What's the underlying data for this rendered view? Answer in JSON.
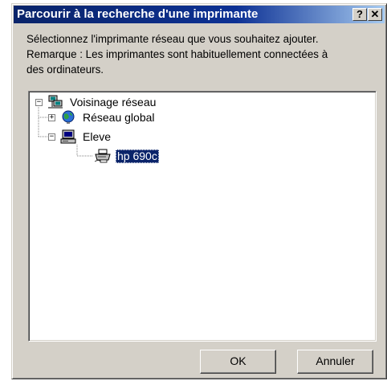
{
  "dialog": {
    "title": "Parcourir à la recherche d'une imprimante",
    "help_label": "?",
    "close_label": "✕"
  },
  "instructions": {
    "line1": "Sélectionnez l'imprimante réseau que vous souhaitez ajouter.",
    "line2": "Remarque : Les imprimantes sont habituellement connectées à",
    "line3": "des ordinateurs."
  },
  "tree": {
    "nodes": [
      {
        "label": "Voisinage réseau",
        "expander": "−",
        "icon": "network-neighborhood-icon",
        "level": 0
      },
      {
        "label": "Réseau global",
        "expander": "+",
        "icon": "globe-icon",
        "level": 1
      },
      {
        "label": "Eleve",
        "expander": "−",
        "icon": "computer-icon",
        "level": 1
      },
      {
        "label": "hp 690c",
        "expander": "",
        "icon": "printer-icon",
        "level": 2,
        "selected": true
      }
    ]
  },
  "buttons": {
    "ok_label": "OK",
    "cancel_label": "Annuler"
  },
  "colors": {
    "title_bar": "#0a246a",
    "dialog_face": "#d4d0c8",
    "selection": "#0a246a"
  }
}
